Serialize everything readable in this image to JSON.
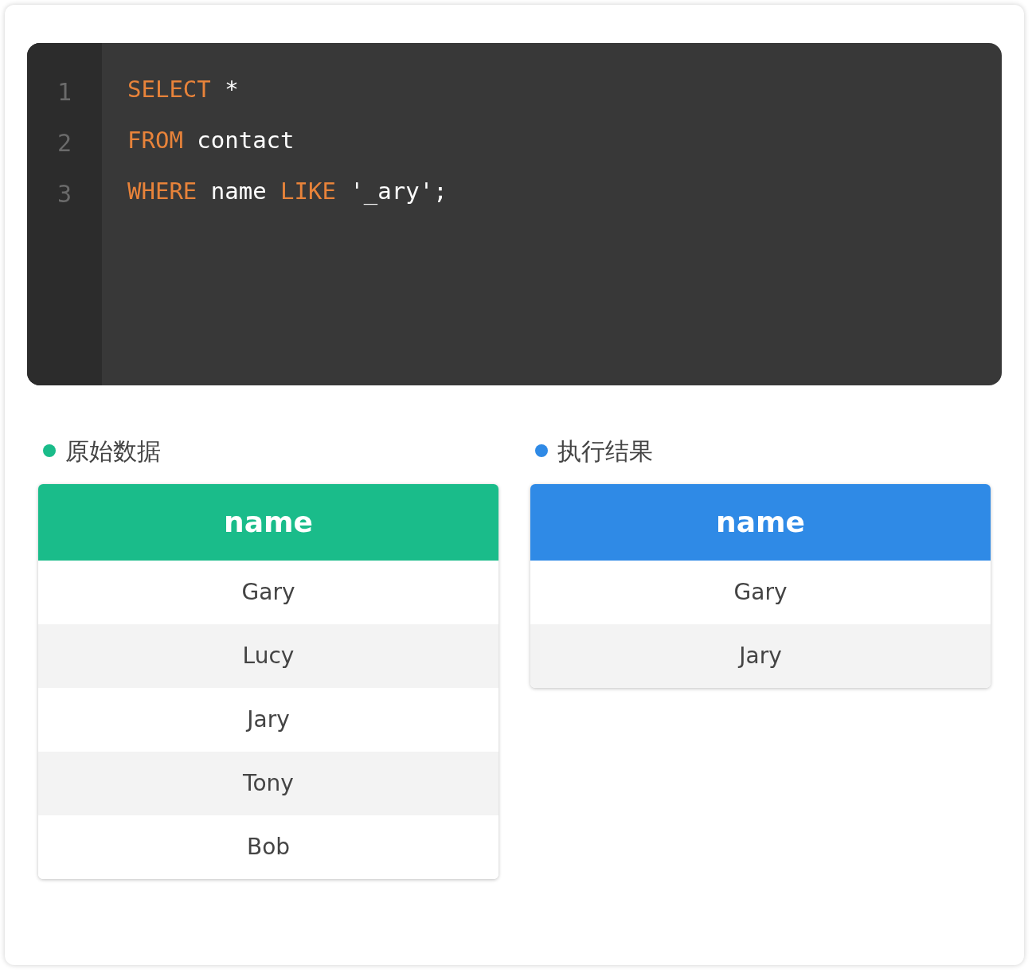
{
  "editor": {
    "lines": [
      {
        "number": "1",
        "tokens": [
          {
            "kind": "keyword",
            "text": "SELECT"
          },
          {
            "kind": "plain",
            "text": " *"
          }
        ]
      },
      {
        "number": "2",
        "tokens": [
          {
            "kind": "keyword",
            "text": "FROM"
          },
          {
            "kind": "plain",
            "text": " contact"
          }
        ]
      },
      {
        "number": "3",
        "tokens": [
          {
            "kind": "keyword",
            "text": "WHERE"
          },
          {
            "kind": "plain",
            "text": " name "
          },
          {
            "kind": "keyword",
            "text": "LIKE"
          },
          {
            "kind": "plain",
            "text": " '_ary';"
          }
        ]
      }
    ]
  },
  "panels": [
    {
      "title": "原始数据",
      "color": "#1abc8a",
      "column": "name",
      "rows": [
        "Gary",
        "Lucy",
        "Jary",
        "Tony",
        "Bob"
      ]
    },
    {
      "title": "执行结果",
      "color": "#2f8ae6",
      "column": "name",
      "rows": [
        "Gary",
        "Jary"
      ]
    }
  ]
}
